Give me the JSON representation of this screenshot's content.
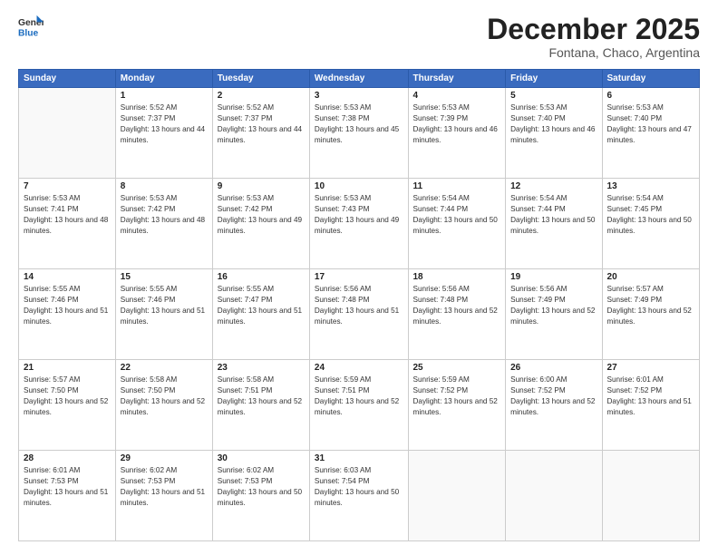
{
  "header": {
    "logo_general": "General",
    "logo_blue": "Blue",
    "month_year": "December 2025",
    "location": "Fontana, Chaco, Argentina"
  },
  "weekdays": [
    "Sunday",
    "Monday",
    "Tuesday",
    "Wednesday",
    "Thursday",
    "Friday",
    "Saturday"
  ],
  "weeks": [
    [
      {
        "day": "",
        "sunrise": "",
        "sunset": "",
        "daylight": ""
      },
      {
        "day": "1",
        "sunrise": "5:52 AM",
        "sunset": "7:37 PM",
        "daylight": "13 hours and 44 minutes."
      },
      {
        "day": "2",
        "sunrise": "5:52 AM",
        "sunset": "7:37 PM",
        "daylight": "13 hours and 44 minutes."
      },
      {
        "day": "3",
        "sunrise": "5:53 AM",
        "sunset": "7:38 PM",
        "daylight": "13 hours and 45 minutes."
      },
      {
        "day": "4",
        "sunrise": "5:53 AM",
        "sunset": "7:39 PM",
        "daylight": "13 hours and 46 minutes."
      },
      {
        "day": "5",
        "sunrise": "5:53 AM",
        "sunset": "7:40 PM",
        "daylight": "13 hours and 46 minutes."
      },
      {
        "day": "6",
        "sunrise": "5:53 AM",
        "sunset": "7:40 PM",
        "daylight": "13 hours and 47 minutes."
      }
    ],
    [
      {
        "day": "7",
        "sunrise": "5:53 AM",
        "sunset": "7:41 PM",
        "daylight": "13 hours and 48 minutes."
      },
      {
        "day": "8",
        "sunrise": "5:53 AM",
        "sunset": "7:42 PM",
        "daylight": "13 hours and 48 minutes."
      },
      {
        "day": "9",
        "sunrise": "5:53 AM",
        "sunset": "7:42 PM",
        "daylight": "13 hours and 49 minutes."
      },
      {
        "day": "10",
        "sunrise": "5:53 AM",
        "sunset": "7:43 PM",
        "daylight": "13 hours and 49 minutes."
      },
      {
        "day": "11",
        "sunrise": "5:54 AM",
        "sunset": "7:44 PM",
        "daylight": "13 hours and 50 minutes."
      },
      {
        "day": "12",
        "sunrise": "5:54 AM",
        "sunset": "7:44 PM",
        "daylight": "13 hours and 50 minutes."
      },
      {
        "day": "13",
        "sunrise": "5:54 AM",
        "sunset": "7:45 PM",
        "daylight": "13 hours and 50 minutes."
      }
    ],
    [
      {
        "day": "14",
        "sunrise": "5:55 AM",
        "sunset": "7:46 PM",
        "daylight": "13 hours and 51 minutes."
      },
      {
        "day": "15",
        "sunrise": "5:55 AM",
        "sunset": "7:46 PM",
        "daylight": "13 hours and 51 minutes."
      },
      {
        "day": "16",
        "sunrise": "5:55 AM",
        "sunset": "7:47 PM",
        "daylight": "13 hours and 51 minutes."
      },
      {
        "day": "17",
        "sunrise": "5:56 AM",
        "sunset": "7:48 PM",
        "daylight": "13 hours and 51 minutes."
      },
      {
        "day": "18",
        "sunrise": "5:56 AM",
        "sunset": "7:48 PM",
        "daylight": "13 hours and 52 minutes."
      },
      {
        "day": "19",
        "sunrise": "5:56 AM",
        "sunset": "7:49 PM",
        "daylight": "13 hours and 52 minutes."
      },
      {
        "day": "20",
        "sunrise": "5:57 AM",
        "sunset": "7:49 PM",
        "daylight": "13 hours and 52 minutes."
      }
    ],
    [
      {
        "day": "21",
        "sunrise": "5:57 AM",
        "sunset": "7:50 PM",
        "daylight": "13 hours and 52 minutes."
      },
      {
        "day": "22",
        "sunrise": "5:58 AM",
        "sunset": "7:50 PM",
        "daylight": "13 hours and 52 minutes."
      },
      {
        "day": "23",
        "sunrise": "5:58 AM",
        "sunset": "7:51 PM",
        "daylight": "13 hours and 52 minutes."
      },
      {
        "day": "24",
        "sunrise": "5:59 AM",
        "sunset": "7:51 PM",
        "daylight": "13 hours and 52 minutes."
      },
      {
        "day": "25",
        "sunrise": "5:59 AM",
        "sunset": "7:52 PM",
        "daylight": "13 hours and 52 minutes."
      },
      {
        "day": "26",
        "sunrise": "6:00 AM",
        "sunset": "7:52 PM",
        "daylight": "13 hours and 52 minutes."
      },
      {
        "day": "27",
        "sunrise": "6:01 AM",
        "sunset": "7:52 PM",
        "daylight": "13 hours and 51 minutes."
      }
    ],
    [
      {
        "day": "28",
        "sunrise": "6:01 AM",
        "sunset": "7:53 PM",
        "daylight": "13 hours and 51 minutes."
      },
      {
        "day": "29",
        "sunrise": "6:02 AM",
        "sunset": "7:53 PM",
        "daylight": "13 hours and 51 minutes."
      },
      {
        "day": "30",
        "sunrise": "6:02 AM",
        "sunset": "7:53 PM",
        "daylight": "13 hours and 50 minutes."
      },
      {
        "day": "31",
        "sunrise": "6:03 AM",
        "sunset": "7:54 PM",
        "daylight": "13 hours and 50 minutes."
      },
      {
        "day": "",
        "sunrise": "",
        "sunset": "",
        "daylight": ""
      },
      {
        "day": "",
        "sunrise": "",
        "sunset": "",
        "daylight": ""
      },
      {
        "day": "",
        "sunrise": "",
        "sunset": "",
        "daylight": ""
      }
    ]
  ]
}
